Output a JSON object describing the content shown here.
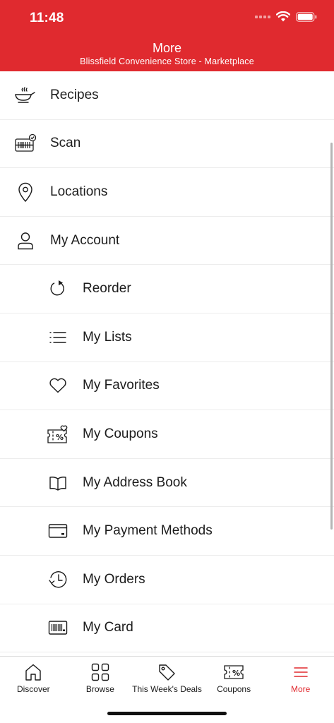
{
  "status_bar": {
    "time": "11:48"
  },
  "header": {
    "title": "More",
    "subtitle": "Blissfield Convenience Store - Marketplace",
    "background": "#e02a2f"
  },
  "menu": {
    "items": [
      {
        "label": "Recipes",
        "icon": "cooking-pan-icon",
        "level": "top"
      },
      {
        "label": "Scan",
        "icon": "barcode-scan-icon",
        "level": "top"
      },
      {
        "label": "Locations",
        "icon": "location-pin-icon",
        "level": "top"
      },
      {
        "label": "My Account",
        "icon": "user-icon",
        "level": "top"
      },
      {
        "label": "Reorder",
        "icon": "reorder-icon",
        "level": "sub"
      },
      {
        "label": "My Lists",
        "icon": "list-icon",
        "level": "sub"
      },
      {
        "label": "My Favorites",
        "icon": "heart-icon",
        "level": "sub"
      },
      {
        "label": "My Coupons",
        "icon": "coupon-heart-icon",
        "level": "sub"
      },
      {
        "label": "My Address Book",
        "icon": "book-icon",
        "level": "sub"
      },
      {
        "label": "My Payment Methods",
        "icon": "credit-card-icon",
        "level": "sub"
      },
      {
        "label": "My Orders",
        "icon": "clock-history-icon",
        "level": "sub"
      },
      {
        "label": "My Card",
        "icon": "barcode-card-icon",
        "level": "sub"
      }
    ]
  },
  "tabbar": {
    "tabs": [
      {
        "label": "Discover",
        "icon": "home-icon"
      },
      {
        "label": "Browse",
        "icon": "grid-icon"
      },
      {
        "label": "This Week's Deals",
        "icon": "tag-icon"
      },
      {
        "label": "Coupons",
        "icon": "coupon-icon"
      },
      {
        "label": "More",
        "icon": "hamburger-menu-icon",
        "active": true
      }
    ],
    "active_color": "#e02a2f"
  }
}
